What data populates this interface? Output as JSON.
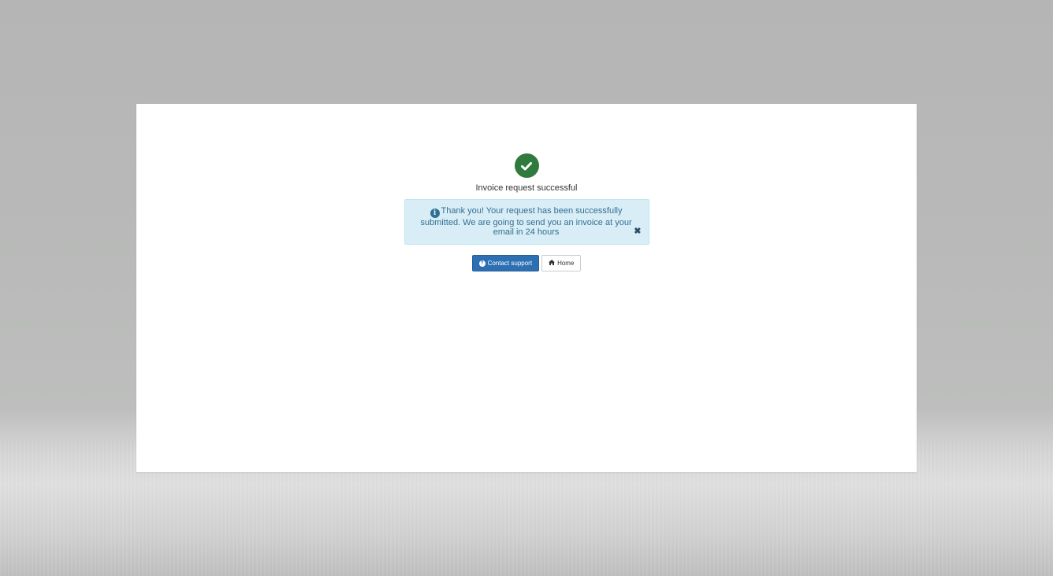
{
  "status": {
    "icon": "check-circle-icon",
    "title": "Invoice request successful"
  },
  "alert": {
    "icon": "info-circle-icon",
    "message": "Thank you! Your request has been successfully submitted. We are going to send you an invoice at your email in 24 hours",
    "close_icon": "close-icon"
  },
  "actions": {
    "contact_label": "Contact support",
    "contact_icon": "question-circle-icon",
    "home_label": "Home",
    "home_icon": "home-icon"
  },
  "colors": {
    "success": "#2f7a3c",
    "alert_bg": "#d9edf7",
    "alert_text": "#31708f",
    "primary": "#2d6fb3"
  }
}
